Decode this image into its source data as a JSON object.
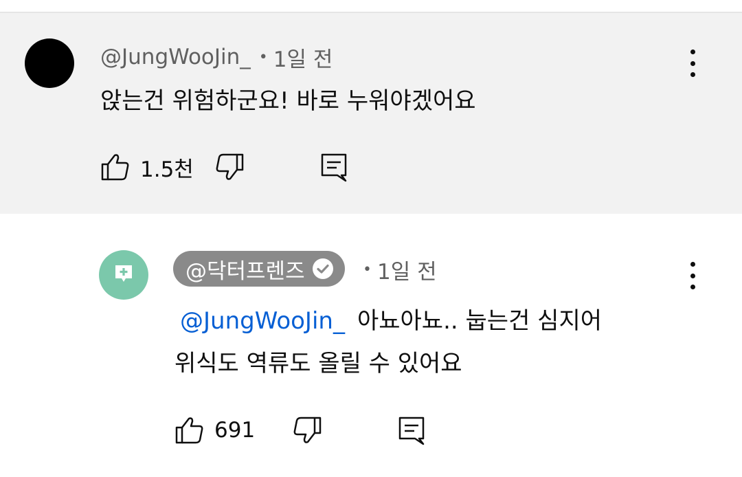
{
  "comment": {
    "author": "@JungWooJin_",
    "separator": "•",
    "time": "1일 전",
    "text": "앉는건 위험하군요! 바로 누워야겠어요",
    "likes": "1.5천"
  },
  "reply": {
    "author": "@닥터프렌즈",
    "separator": "•",
    "time": "1일 전",
    "mention": "@JungWooJin_",
    "text_line1": "아뇨아뇨.. 눕는건 심지어",
    "text_line2": "위식도 역류도 올릴 수 있어요",
    "likes": "691"
  },
  "icons": {
    "like": "thumb-up-icon",
    "dislike": "thumb-down-icon",
    "reply": "comment-reply-icon",
    "more": "more-vert-icon",
    "verified": "verified-check-icon",
    "channel": "channel-plus-icon"
  },
  "colors": {
    "highlight_bg": "#f2f2f2",
    "mention": "#065fd4",
    "channel_avatar": "#7bc8ab",
    "chip_bg": "#8a8a8a"
  }
}
